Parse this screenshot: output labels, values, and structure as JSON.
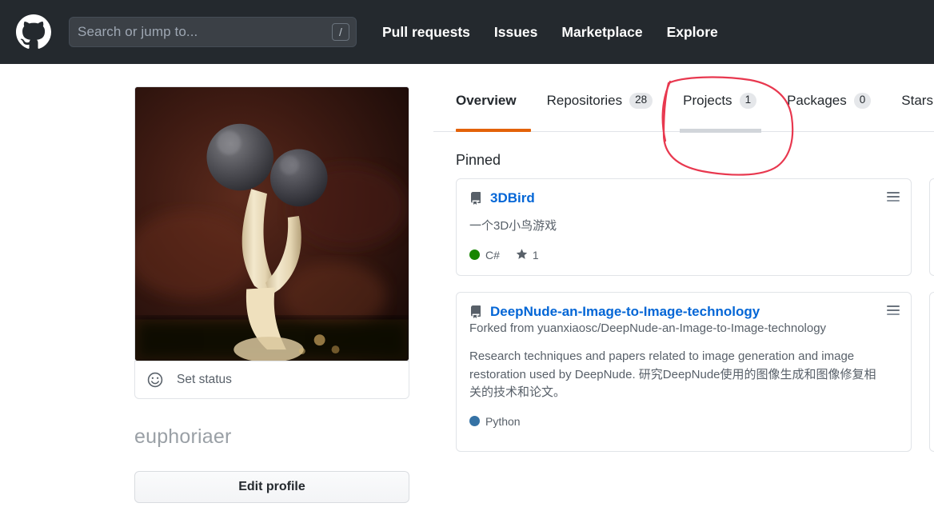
{
  "header": {
    "logo_icon": "github-mark-icon",
    "search": {
      "placeholder": "Search or jump to...",
      "value": "",
      "shortcut_key": "/"
    },
    "nav": [
      {
        "label": "Pull requests"
      },
      {
        "label": "Issues"
      },
      {
        "label": "Marketplace"
      },
      {
        "label": "Explore"
      }
    ],
    "background_color": "#24292e"
  },
  "profile": {
    "avatar_alt": "Macro photo of two dark spherical fungus heads on pale stalks",
    "status": {
      "icon": "smiley-icon",
      "label": "Set status"
    },
    "username": "euphoriaer",
    "edit_profile_label": "Edit profile"
  },
  "tabs": {
    "items": [
      {
        "label": "Overview",
        "count": null,
        "selected": true
      },
      {
        "label": "Repositories",
        "count": "28",
        "selected": false
      },
      {
        "label": "Projects",
        "count": "1",
        "selected": false
      },
      {
        "label": "Packages",
        "count": "0",
        "selected": false
      },
      {
        "label": "Stars",
        "count": "",
        "selected": false
      }
    ],
    "selected_underline_color": "#e36209"
  },
  "pinned": {
    "heading": "Pinned",
    "cards": [
      {
        "name": "3DBird",
        "icon": "repo-icon",
        "forked_from": null,
        "description": "一个3D小鸟游戏",
        "language": "C#",
        "language_color": "#178600",
        "stars": "1",
        "menu_icon": "grabber-icon"
      },
      {
        "name": "DeepNude-an-Image-to-Image-technology",
        "icon": "repo-icon",
        "forked_from": "Forked from yuanxiaosc/DeepNude-an-Image-to-Image-technology",
        "description": "Research techniques and papers related to image generation and image restoration used by DeepNude. 研究DeepNude使用的图像生成和图像修复相关的技术和论文。",
        "language": "Python",
        "language_color": "#3572a5",
        "stars": null,
        "menu_icon": "grabber-icon"
      }
    ]
  },
  "annotation": {
    "type": "hand-drawn-circle",
    "color": "#e8384f",
    "targets": "Projects tab"
  }
}
